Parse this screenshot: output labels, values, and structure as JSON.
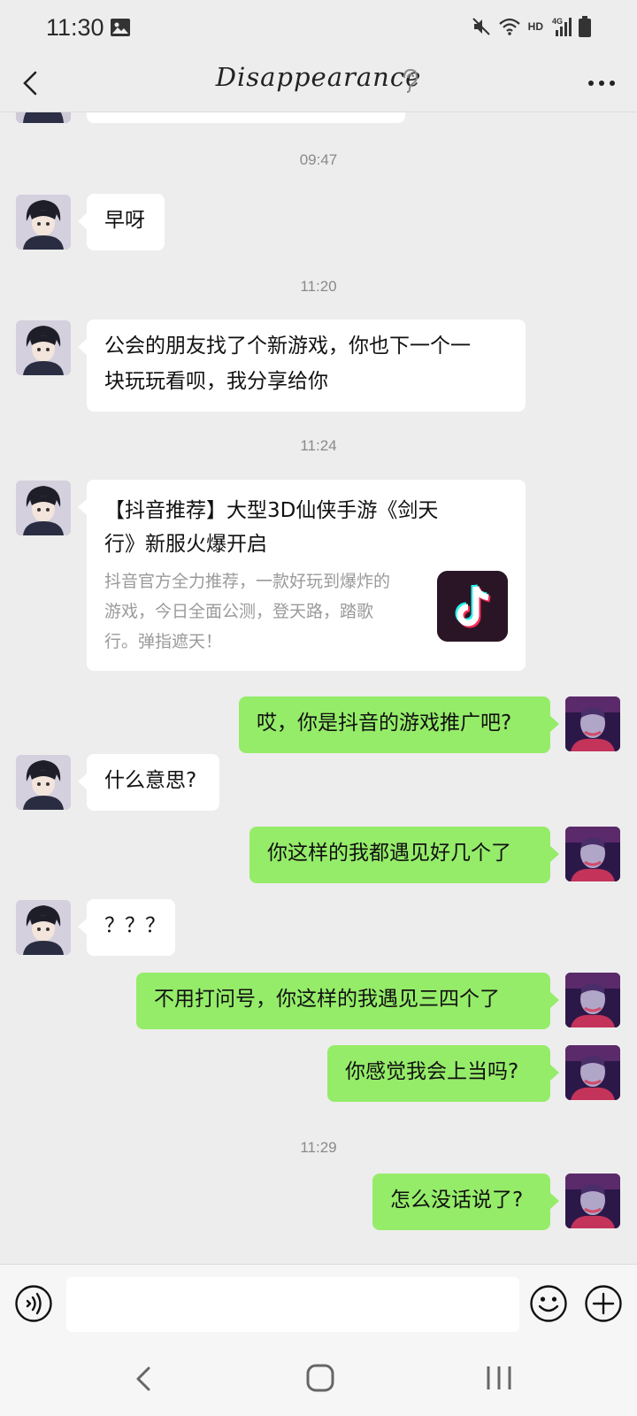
{
  "status_bar": {
    "time": "11:30",
    "network": "HD",
    "icons": [
      "gallery-icon",
      "mute-icon",
      "wifi-icon",
      "signal-4g-icon",
      "battery-icon"
    ]
  },
  "header": {
    "title": "Disappearance",
    "back_icon": "back-chevron-icon",
    "ear_icon": "ear-icon",
    "more_icon": "more-dots-icon"
  },
  "messages": [
    {
      "type": "timestamp",
      "text": "09:47"
    },
    {
      "type": "text",
      "from": "contact",
      "text": "早呀"
    },
    {
      "type": "timestamp",
      "text": "11:20"
    },
    {
      "type": "text",
      "from": "contact",
      "lines": [
        "公会的朋友找了个新游戏，你也下一个一",
        "块玩玩看呗，我分享给你"
      ]
    },
    {
      "type": "timestamp",
      "text": "11:24"
    },
    {
      "type": "link_card",
      "from": "contact",
      "title_lines": [
        "【抖音推荐】大型3D仙侠手游《剑天",
        "行》新服火爆开启"
      ],
      "desc_lines": [
        "抖音官方全力推荐，一款好玩到爆炸的",
        "游戏，今日全面公测，登天路，踏歌",
        "行。弹指遮天！"
      ],
      "icon": "tiktok-icon"
    },
    {
      "type": "text",
      "from": "me",
      "text": "哎，你是抖音的游戏推广吧?"
    },
    {
      "type": "text",
      "from": "contact",
      "text": "什么意思?"
    },
    {
      "type": "text",
      "from": "me",
      "text": "你这样的我都遇见好几个了"
    },
    {
      "type": "text",
      "from": "contact",
      "text": "？？？"
    },
    {
      "type": "text",
      "from": "me",
      "text": "不用打问号，你这样的我遇见三四个了"
    },
    {
      "type": "text",
      "from": "me",
      "text": "你感觉我会上当吗?"
    },
    {
      "type": "timestamp",
      "text": "11:29"
    },
    {
      "type": "text",
      "from": "me",
      "text": "怎么没话说了?"
    }
  ],
  "input_bar": {
    "voice_icon": "voice-icon",
    "emoji_icon": "emoji-icon",
    "plus_icon": "plus-icon",
    "value": ""
  },
  "colors": {
    "background": "#ededed",
    "my_bubble": "#95ec69",
    "contact_bubble": "#ffffff",
    "timestamp": "#8a8a8a"
  }
}
